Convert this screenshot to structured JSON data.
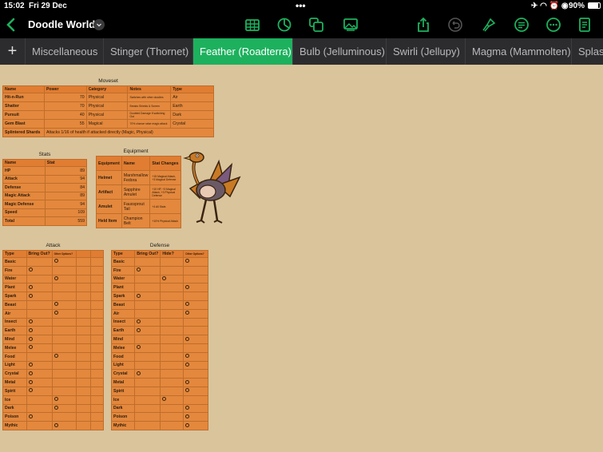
{
  "status": {
    "time": "15:02",
    "date": "Fri 29 Dec",
    "battery": "90%"
  },
  "toolbar": {
    "title": "Doodle World",
    "icons": [
      "back-icon",
      "chevron-down-icon",
      "table-icon",
      "chart-icon",
      "shapes-icon",
      "media-icon",
      "share-icon",
      "undo-icon",
      "format-brush-icon",
      "comment-icon",
      "more-icon",
      "document-icon"
    ]
  },
  "tabs": [
    {
      "label": "Miscellaneous"
    },
    {
      "label": "Stinger (Thornet)"
    },
    {
      "label": "Feather (Roadterra)",
      "active": true
    },
    {
      "label": "Bulb (Jelluminous)"
    },
    {
      "label": "Swirli (Jellupy)"
    },
    {
      "label": "Magma (Mammolten)"
    },
    {
      "label": "Splas"
    }
  ],
  "colors": {
    "accent": "#1db15e",
    "sheet": "#d9c49c",
    "table": "#e3883d"
  },
  "moveset": {
    "title": "Moveset",
    "headers": [
      "Name",
      "Power",
      "Category",
      "Notes",
      "Type"
    ],
    "rows": [
      [
        "Hit-n-Run",
        "70",
        "Physical",
        "Switches with other doodles",
        "Air"
      ],
      [
        "Shatter",
        "70",
        "Physical",
        "Breaks Shields & Screen",
        "Earth"
      ],
      [
        "Pursuit",
        "40",
        "Physical",
        "Doubled Damage if switching Out",
        "Dark"
      ],
      [
        "Gem Blast",
        "55",
        "Magical",
        "70% chance raise magic attack",
        "Crystal"
      ]
    ],
    "last_row": [
      "Splintered Shards",
      "Attacks 1/16 of health if attacked directly (Magic, Physical)"
    ]
  },
  "stats": {
    "title": "Stats",
    "headers": [
      "Name",
      "Stat"
    ],
    "rows": [
      [
        "HP",
        "89"
      ],
      [
        "Attack",
        "94"
      ],
      [
        "Defense",
        "84"
      ],
      [
        "Magic Attack",
        "89"
      ],
      [
        "Magic Defense",
        "94"
      ],
      [
        "Speed",
        "109"
      ],
      [
        "Total",
        "559"
      ]
    ]
  },
  "equipment": {
    "title": "Equipment",
    "headers": [
      "Equipment",
      "Name",
      "Stat Changes"
    ],
    "rows": [
      [
        "Helmet",
        "Marshmallow Fedora",
        "+15 Magical Attack, +3 Magical Defense"
      ],
      [
        "Artifact",
        "Sapphire Amulet",
        "+10 HP, +3 Magical Attack, +3 Physical Defense"
      ],
      [
        "Amulet",
        "Fauxsprout Tail",
        "+4 All Stats"
      ],
      [
        "Held Item",
        "Champion Belt",
        "+10% Physical Attack"
      ]
    ]
  },
  "attack": {
    "title": "Attack",
    "headers": [
      "Type",
      "Bring Out?",
      "Other Options?",
      "",
      ""
    ],
    "rows": [
      [
        "Basic",
        1
      ],
      [
        "Fire",
        0
      ],
      [
        "Water",
        1
      ],
      [
        "Plant",
        0
      ],
      [
        "Spark",
        0
      ],
      [
        "Beast",
        1
      ],
      [
        "Air",
        1
      ],
      [
        "Insect",
        0
      ],
      [
        "Earth",
        0
      ],
      [
        "Mind",
        0
      ],
      [
        "Melee",
        0
      ],
      [
        "Food",
        1
      ],
      [
        "Light",
        0
      ],
      [
        "Crystal",
        0
      ],
      [
        "Metal",
        0
      ],
      [
        "Spirit",
        0
      ],
      [
        "Ice",
        1
      ],
      [
        "Dark",
        1
      ],
      [
        "Poison",
        0
      ],
      [
        "Mythic",
        1
      ]
    ]
  },
  "defense": {
    "title": "Defense",
    "headers": [
      "Type",
      "Bring Out?",
      "Hide?",
      "Other Options?"
    ],
    "rows": [
      [
        "Basic",
        2
      ],
      [
        "Fire",
        0
      ],
      [
        "Water",
        1
      ],
      [
        "Plant",
        2
      ],
      [
        "Spark",
        0
      ],
      [
        "Beast",
        2
      ],
      [
        "Air",
        2
      ],
      [
        "Insect",
        0
      ],
      [
        "Earth",
        0
      ],
      [
        "Mind",
        2
      ],
      [
        "Melee",
        0
      ],
      [
        "Food",
        2
      ],
      [
        "Light",
        2
      ],
      [
        "Crystal",
        0
      ],
      [
        "Metal",
        2
      ],
      [
        "Spirit",
        2
      ],
      [
        "Ice",
        1
      ],
      [
        "Dark",
        2
      ],
      [
        "Poison",
        2
      ],
      [
        "Mythic",
        2
      ]
    ]
  }
}
